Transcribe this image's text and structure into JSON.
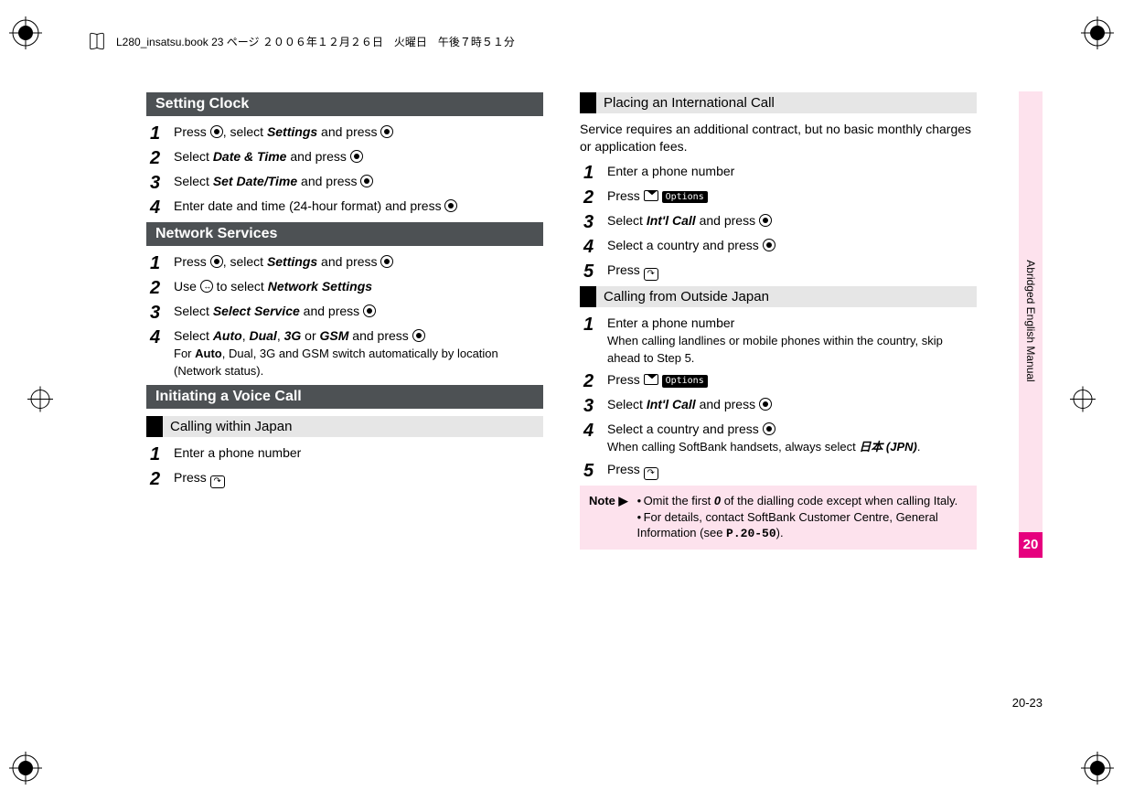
{
  "header": {
    "text": "L280_insatsu.book  23 ページ  ２００６年１２月２６日　火曜日　午後７時５１分"
  },
  "sideTab": {
    "label": "Abridged English Manual",
    "chapter": "20"
  },
  "pageNumber": "20-23",
  "left": {
    "sec1": {
      "title": "Setting Clock",
      "s1a": "Press ",
      "s1b": ", select ",
      "s1c": "Settings",
      "s1d": " and press ",
      "s2a": "Select ",
      "s2b": "Date & Time",
      "s2c": " and press ",
      "s3a": "Select ",
      "s3b": "Set Date/Time",
      "s3c": " and press ",
      "s4a": "Enter date and time (24-hour format) and press "
    },
    "sec2": {
      "title": "Network Services",
      "s1a": "Press ",
      "s1b": ", select ",
      "s1c": "Settings",
      "s1d": " and press ",
      "s2a": "Use ",
      "s2b": " to select ",
      "s2c": "Network Settings",
      "s3a": "Select ",
      "s3b": "Select Service",
      "s3c": " and press ",
      "s4a": "Select ",
      "s4b": "Auto",
      "s4c": ", ",
      "s4d": "Dual",
      "s4e": ", ",
      "s4f": "3G",
      "s4g": " or ",
      "s4h": "GSM",
      "s4i": " and press ",
      "s4sub1": "For ",
      "s4sub2": "Auto",
      "s4sub3": ", Dual, 3G and GSM switch automatically by location (Network status)."
    },
    "sec3": {
      "title": "Initiating a Voice Call",
      "sub1": "Calling within Japan",
      "s1": "Enter a phone number",
      "s2": "Press "
    }
  },
  "right": {
    "sub1": "Placing an International Call",
    "intro": "Service requires an additional contract, but no basic monthly charges or application fees.",
    "a1": "Enter a phone number",
    "a2": "Press ",
    "a2pill": "Options",
    "a3a": "Select ",
    "a3b": "Int'l Call",
    "a3c": " and press ",
    "a4": "Select a country and press ",
    "a5": "Press ",
    "sub2": "Calling from Outside Japan",
    "b1a": "Enter a phone number",
    "b1b": "When calling landlines or mobile phones within the country, skip ahead to Step 5.",
    "b2": "Press ",
    "b2pill": "Options",
    "b3a": "Select ",
    "b3b": "Int'l Call",
    "b3c": " and press ",
    "b4a": "Select a country and press ",
    "b4b1": "When calling SoftBank handsets, always select ",
    "b4b2": "日本 (JPN)",
    "b4b3": ".",
    "b5": "Press ",
    "noteLabel": "Note ▶",
    "note1a": "Omit the first ",
    "note1b": "0",
    "note1c": " of the dialling code except when calling Italy.",
    "note2a": "For details, contact SoftBank Customer Centre, General Information (see ",
    "note2b": "P.20-50",
    "note2c": ")."
  }
}
